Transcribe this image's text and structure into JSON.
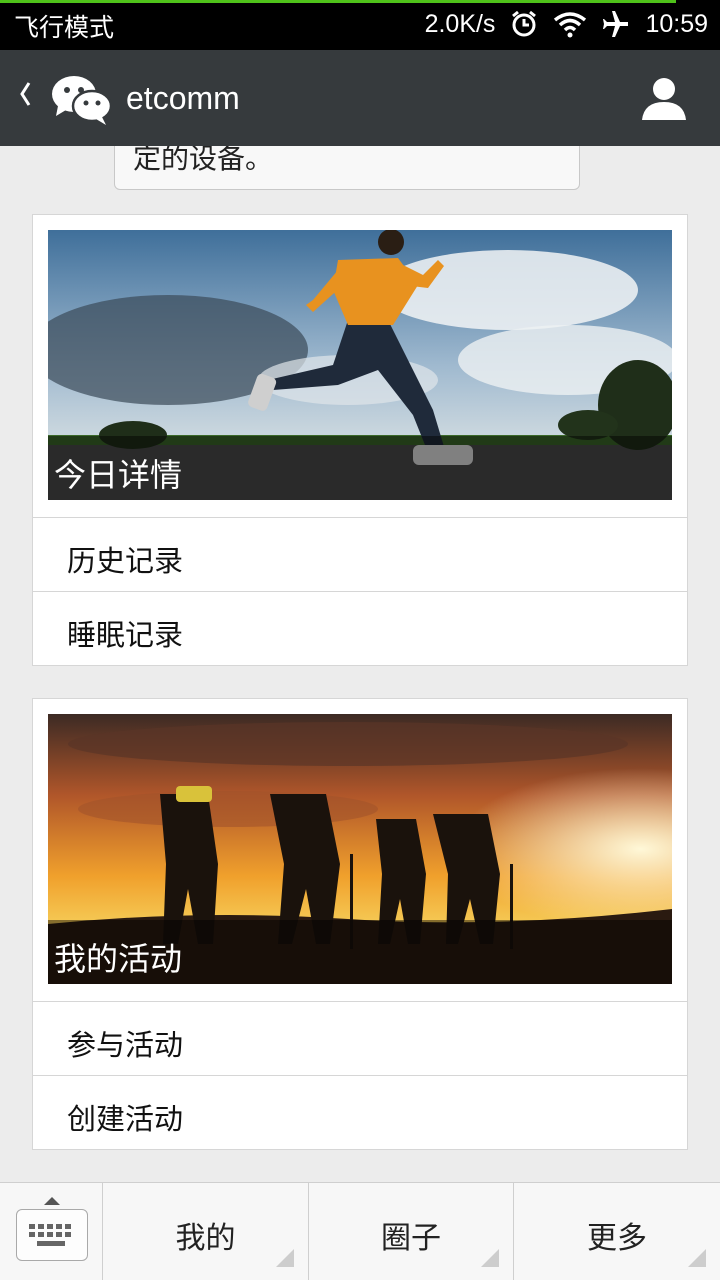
{
  "status_bar": {
    "mode_text": "飞行模式",
    "speed": "2.0K/s",
    "time": "10:59",
    "icons": [
      "alarm-icon",
      "wifi-icon",
      "airplane-icon"
    ]
  },
  "header": {
    "title": "etcomm",
    "back_icon": "chevron-left-icon",
    "logo_icon": "wechat-logo-icon",
    "profile_icon": "person-icon"
  },
  "message": {
    "text": "定的设备。"
  },
  "cards": [
    {
      "banner_caption": "今日详情",
      "banner_image": "runner-photo",
      "rows": [
        "历史记录",
        "睡眠记录"
      ]
    },
    {
      "banner_caption": "我的活动",
      "banner_image": "hikers-sunset-photo",
      "rows": [
        "参与活动",
        "创建活动"
      ]
    }
  ],
  "bottom_bar": {
    "keyboard_icon": "keyboard-icon",
    "tabs": [
      "我的",
      "圈子",
      "更多"
    ]
  },
  "colors": {
    "header_bg": "#363a3d",
    "status_bg": "#000000",
    "page_bg": "#ececec",
    "progress_green": "#4fc21a"
  }
}
